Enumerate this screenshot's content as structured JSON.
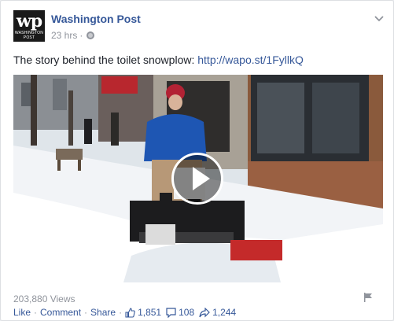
{
  "post": {
    "page_name": "Washington Post",
    "avatar_logo": "wp",
    "avatar_sub": "WASHINGTON POST",
    "time": "23 hrs",
    "meta_sep": "·",
    "text": "The story behind the toilet snowplow: ",
    "link": "http://wapo.st/1FyllkQ"
  },
  "video": {
    "views": "203,880 Views",
    "play_icon": "play-icon"
  },
  "actions": {
    "like": "Like",
    "comment": "Comment",
    "share": "Share",
    "sep": "·",
    "likes_count": "1,851",
    "comments_count": "108",
    "shares_count": "1,244"
  },
  "colors": {
    "link": "#365899",
    "meta": "#90949c",
    "text": "#1d2129"
  }
}
